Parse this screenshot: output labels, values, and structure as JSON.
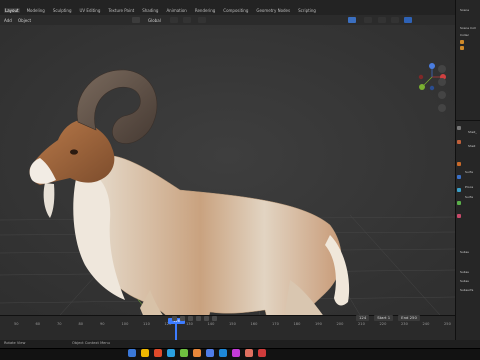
{
  "tabs": [
    "Layout",
    "Modeling",
    "Sculpting",
    "UV Editing",
    "Texture Paint",
    "Shading",
    "Animation",
    "Rendering",
    "Compositing",
    "Geometry Nodes",
    "Scripting"
  ],
  "active_tab": "Layout",
  "editbar": {
    "add": "Add",
    "object": "Object",
    "transform": "Global",
    "options": "Options"
  },
  "scene_label": "Scene",
  "outliner": {
    "collection": "Collec",
    "name": "Scene Coll"
  },
  "properties": {
    "object_name": "Shell_",
    "sub": "Shell"
  },
  "timeline": {
    "ticks": [
      "50",
      "60",
      "70",
      "80",
      "90",
      "100",
      "110",
      "120",
      "130",
      "140",
      "150",
      "160",
      "170",
      "180",
      "190",
      "200",
      "210",
      "220",
      "230",
      "240",
      "250"
    ],
    "current_frame": "126",
    "start_label": "Start",
    "start": "1",
    "end_label": "End",
    "end": "250",
    "frame_now": "124"
  },
  "status": {
    "left": "Rotate View",
    "mid": "Object Context Menu"
  },
  "right_labels": [
    "Subsu",
    "Subsu",
    "Subsu",
    "Subsurfa",
    "Proce",
    "Surfa"
  ],
  "taskbar_colors": [
    "#3a78d8",
    "#f0b800",
    "#e04a2a",
    "#2aa0e0",
    "#6fc040",
    "#e8873a",
    "#4f7de8",
    "#1e88d8",
    "#c43bd8",
    "#e07060",
    "#d03b3b"
  ]
}
